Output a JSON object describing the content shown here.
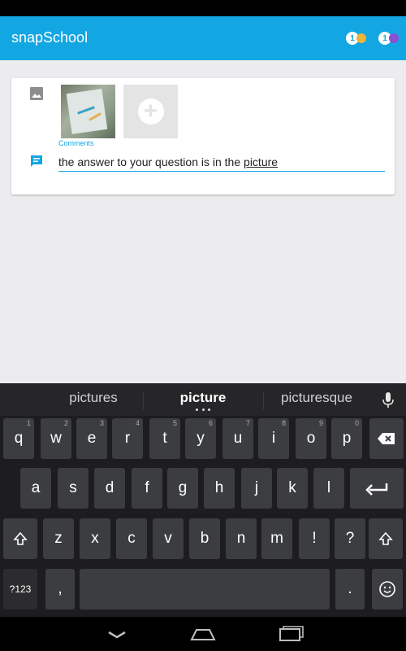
{
  "app": {
    "title": "snapSchool"
  },
  "badges": [
    {
      "count": "1",
      "color": "#f0b43a"
    },
    {
      "count": "1",
      "color": "#8a4fd6"
    }
  ],
  "question": {
    "comments_label": "Comments",
    "answer_text_prefix": "the answer to your question is in the ",
    "answer_text_word": "picture"
  },
  "keyboard": {
    "suggestions": [
      "pictures",
      "picture",
      "picturesque"
    ],
    "row1": [
      {
        "k": "q",
        "h": "1"
      },
      {
        "k": "w",
        "h": "2"
      },
      {
        "k": "e",
        "h": "3"
      },
      {
        "k": "r",
        "h": "4"
      },
      {
        "k": "t",
        "h": "5"
      },
      {
        "k": "y",
        "h": "6"
      },
      {
        "k": "u",
        "h": "7"
      },
      {
        "k": "i",
        "h": "8"
      },
      {
        "k": "o",
        "h": "9"
      },
      {
        "k": "p",
        "h": "0"
      }
    ],
    "row2": [
      "a",
      "s",
      "d",
      "f",
      "g",
      "h",
      "j",
      "k",
      "l"
    ],
    "row3": [
      "z",
      "x",
      "c",
      "v",
      "b",
      "n",
      "m",
      "!",
      "?"
    ],
    "symbols_label": "?123",
    "comma_label": ",",
    "period_label": "."
  },
  "colors": {
    "accent": "#12a6e2",
    "keyboard_bg": "#1d1d1f",
    "key_bg": "#3c3d40"
  }
}
